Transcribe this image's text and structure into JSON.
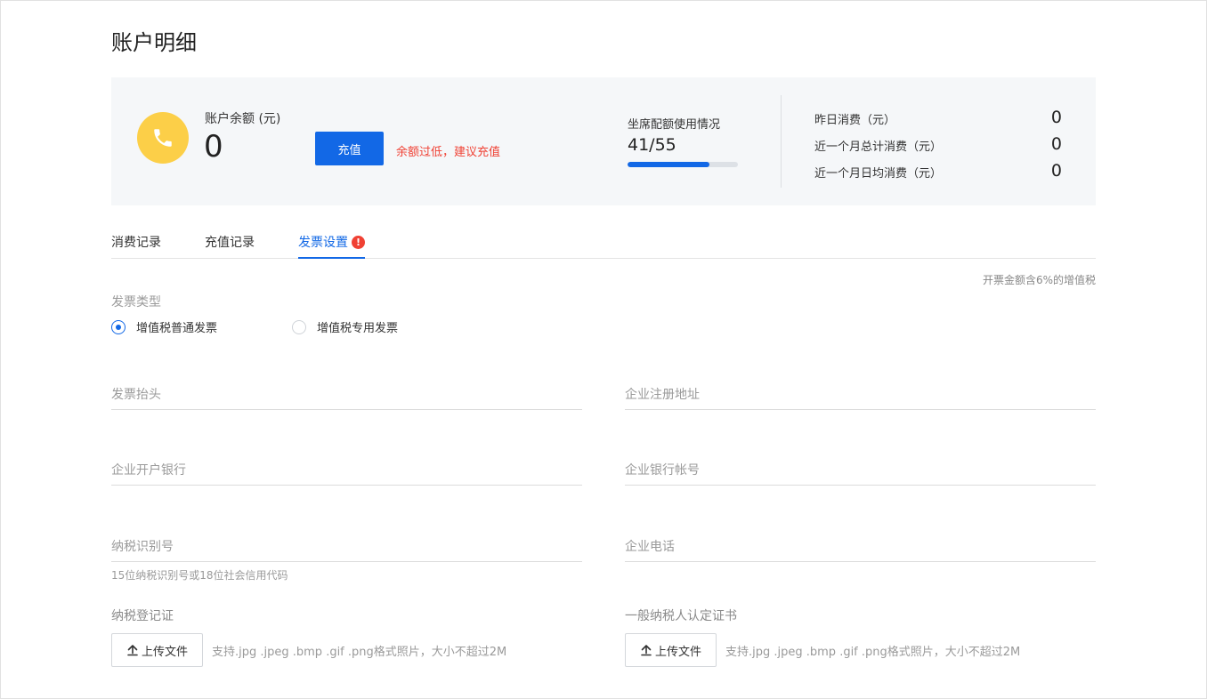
{
  "page": {
    "title": "账户明细"
  },
  "summary": {
    "icon": "phone-icon",
    "balance_label": "账户余额 (元)",
    "balance_value": "0",
    "recharge_button": "充值",
    "low_balance_warning": "余额过低，建议充值",
    "quota_label": "坐席配额使用情况",
    "quota_value": "41/55",
    "quota_used": 41,
    "quota_total": 55,
    "stats": [
      {
        "label": "昨日消费（元）",
        "value": "0"
      },
      {
        "label": "近一个月总计消费（元）",
        "value": "0"
      },
      {
        "label": "近一个月日均消费（元）",
        "value": "0"
      }
    ]
  },
  "tabs": [
    {
      "label": "消费记录",
      "active": false
    },
    {
      "label": "充值记录",
      "active": false
    },
    {
      "label": "发票设置",
      "active": true,
      "alert": "!"
    }
  ],
  "invoice": {
    "tax_note": "开票金额含6%的增值税",
    "type_label": "发票类型",
    "types": [
      {
        "label": "增值税普通发票",
        "checked": true
      },
      {
        "label": "增值税专用发票",
        "checked": false
      }
    ],
    "fields": {
      "title": {
        "placeholder": "发票抬头",
        "value": ""
      },
      "address": {
        "placeholder": "企业注册地址",
        "value": ""
      },
      "bank": {
        "placeholder": "企业开户银行",
        "value": ""
      },
      "account": {
        "placeholder": "企业银行帐号",
        "value": ""
      },
      "tax_id": {
        "placeholder": "纳税识别号",
        "value": "",
        "hint": "15位纳税识别号或18位社会信用代码"
      },
      "phone": {
        "placeholder": "企业电话",
        "value": ""
      }
    },
    "uploads": [
      {
        "label": "纳税登记证",
        "button": "上传文件",
        "hint": "支持.jpg .jpeg .bmp .gif .png格式照片，大小不超过2M"
      },
      {
        "label": "一般纳税人认定证书",
        "button": "上传文件",
        "hint": "支持.jpg .jpeg .bmp .gif .png格式照片，大小不超过2M"
      }
    ]
  },
  "colors": {
    "accent": "#1268e6",
    "warning": "#f04134",
    "phone_badge": "#fccf48",
    "summary_bg": "#f5f7f9"
  }
}
